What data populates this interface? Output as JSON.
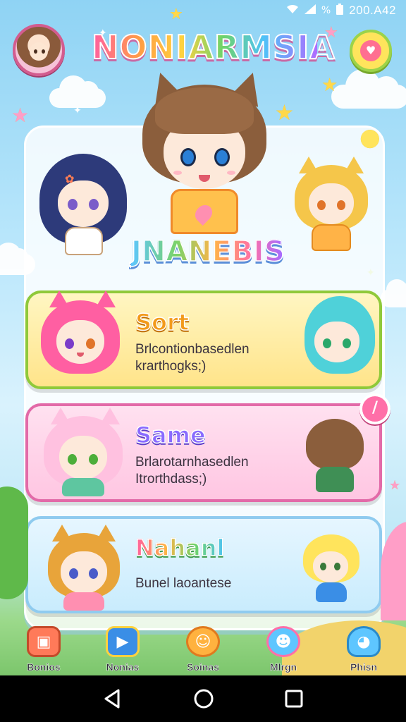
{
  "status_bar": {
    "time": "200.A42",
    "battery": "%"
  },
  "header": {
    "app_title": "NONIARMSIA"
  },
  "featured": {
    "name": "JNANEBIS"
  },
  "cards": [
    {
      "title": "Sort",
      "description": "Brlcontionbasedlen krarthogks;)"
    },
    {
      "title": "Same",
      "description": "Brlarotarnhasedlen Itrorthdass;)"
    },
    {
      "title": "Nahanl",
      "description": "Bunel laoantese"
    }
  ],
  "bottom_nav": [
    {
      "label": "Bonios",
      "icon": "board-icon",
      "color": "#ff7a59"
    },
    {
      "label": "Nonias",
      "icon": "play-icon",
      "color": "#3a8ee6"
    },
    {
      "label": "Soinas",
      "icon": "character-icon",
      "color": "#ffb23f"
    },
    {
      "label": "Mlrgn",
      "icon": "monster-icon",
      "color": "#ff6fa8"
    },
    {
      "label": "Phisn",
      "icon": "pet-icon",
      "color": "#5ec6ff"
    }
  ]
}
